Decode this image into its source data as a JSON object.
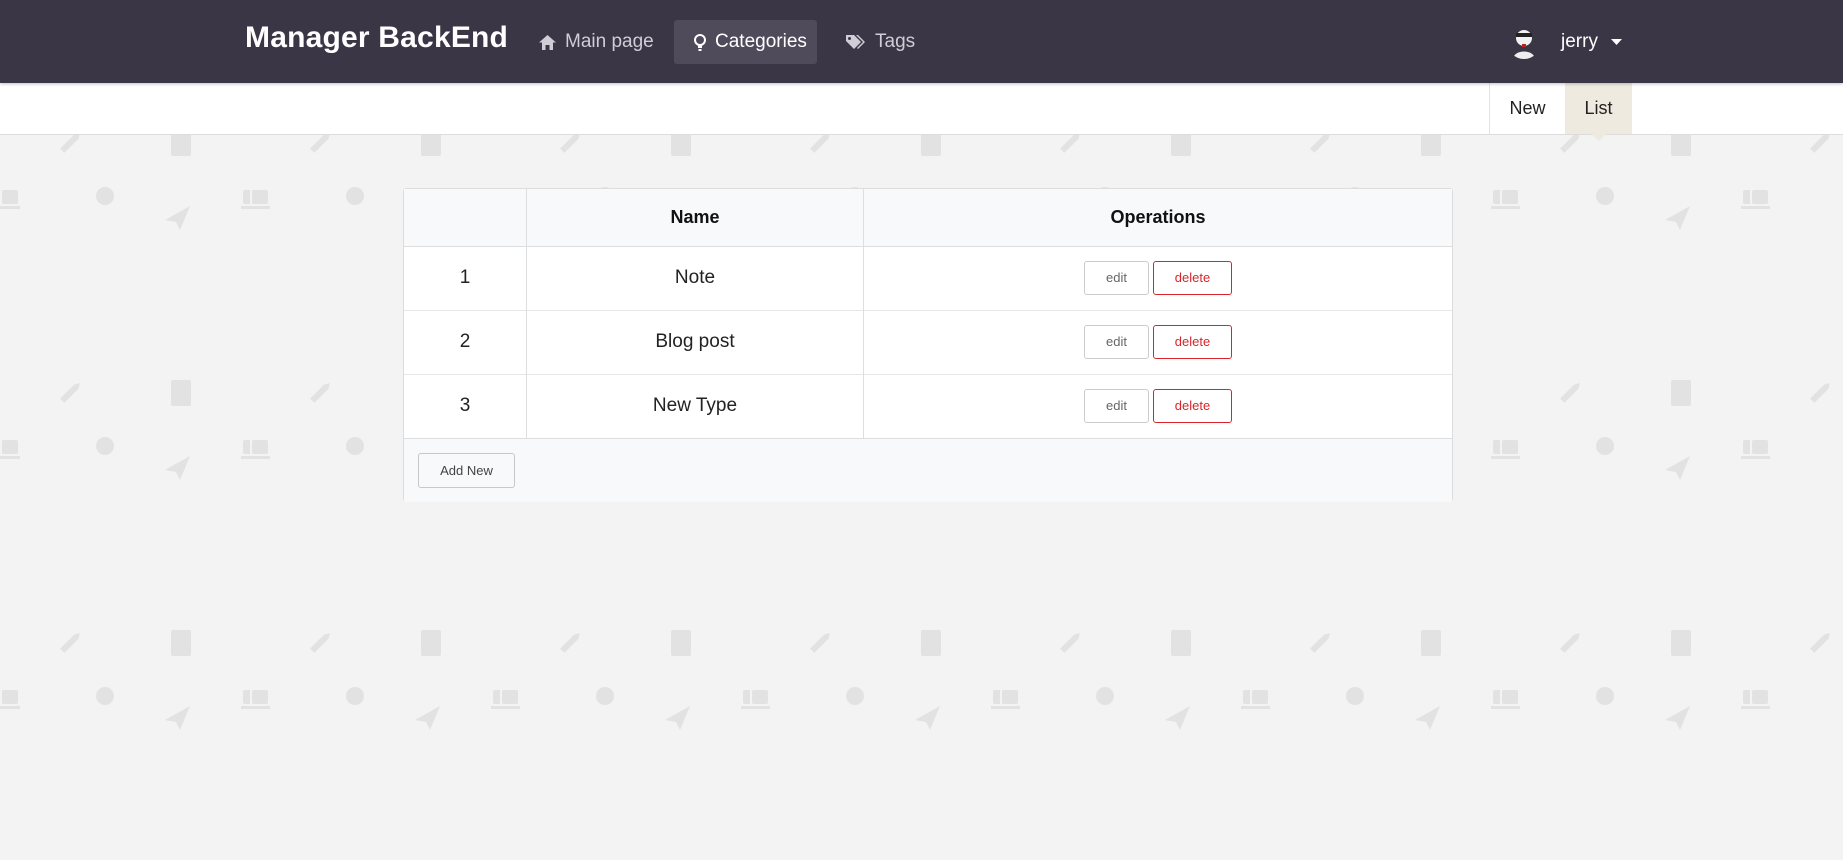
{
  "brand": "Manager BackEnd",
  "nav": [
    {
      "label": "Main page",
      "icon": "home-icon"
    },
    {
      "label": "Categories",
      "icon": "lightbulb-icon",
      "active": true
    },
    {
      "label": "Tags",
      "icon": "tags-icon"
    }
  ],
  "user": {
    "name": "jerry"
  },
  "subnav": {
    "new_label": "New",
    "list_label": "List"
  },
  "table": {
    "headers": [
      "",
      "Name",
      "Operations"
    ],
    "rows": [
      {
        "index": "1",
        "name": "Note"
      },
      {
        "index": "2",
        "name": "Blog post"
      },
      {
        "index": "3",
        "name": "New Type"
      }
    ],
    "edit_label": "edit",
    "delete_label": "delete",
    "add_new_label": "Add New"
  },
  "colors": {
    "navbar": "#3a3646",
    "active_nav": "#4f4b5b",
    "delete": "#d9252a",
    "list_tab": "#efeae0",
    "background": "#f3f3f3"
  }
}
